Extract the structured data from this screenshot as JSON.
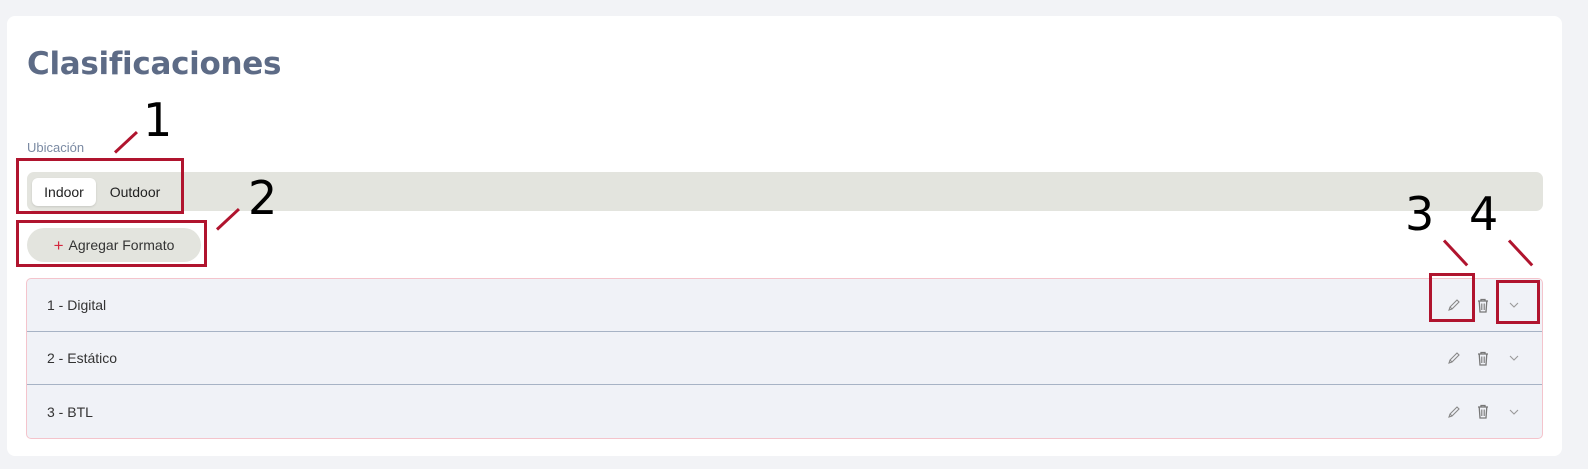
{
  "page": {
    "title": "Clasificaciones"
  },
  "location": {
    "label": "Ubicación",
    "options": [
      "Indoor",
      "Outdoor"
    ],
    "selected": "Indoor"
  },
  "add_button": {
    "plus": "+",
    "label": "Agregar Formato"
  },
  "formats": [
    {
      "label": "1 - Digital"
    },
    {
      "label": "2 - Estático"
    },
    {
      "label": "3 - BTL"
    }
  ],
  "annotations": [
    "1",
    "2",
    "3",
    "4"
  ],
  "colors": {
    "title": "#5d6b86",
    "accent_red": "#d4283f",
    "annotation_red": "#b0142e",
    "segment_bg": "#e3e4de",
    "row_bg": "#f0f2f7"
  },
  "icons": [
    "pencil-icon",
    "trash-icon",
    "chevron-down-icon"
  ]
}
